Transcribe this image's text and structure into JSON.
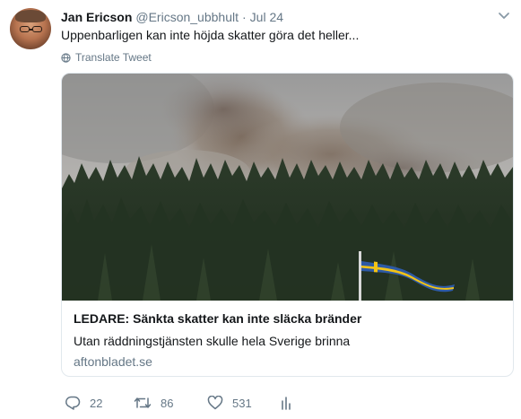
{
  "tweet": {
    "author_name": "Jan Ericson",
    "author_handle": "@Ericson_ubbhult",
    "separator": "·",
    "date": "Jul 24",
    "text": "Uppenbarligen kan inte höjda skatter göra det heller...",
    "translate_label": "Translate Tweet"
  },
  "card": {
    "title": "LEDARE: Sänkta skatter kan inte släcka bränder",
    "description": "Utan räddningstjänsten skulle hela Sverige brinna",
    "domain": "aftonbladet.se",
    "image_description": "forest-fire-smoke-with-swedish-flag"
  },
  "actions": {
    "replies": "22",
    "retweets": "86",
    "likes": "531"
  },
  "icons": {
    "caret": "chevron-down-icon",
    "globe": "globe-icon",
    "reply": "reply-icon",
    "retweet": "retweet-icon",
    "like": "heart-icon",
    "stats": "analytics-icon"
  },
  "colors": {
    "text_primary": "#14171a",
    "text_secondary": "#657786",
    "border": "#e1e8ed",
    "flag_blue": "#2d5aa6",
    "flag_yellow": "#f2c316"
  }
}
